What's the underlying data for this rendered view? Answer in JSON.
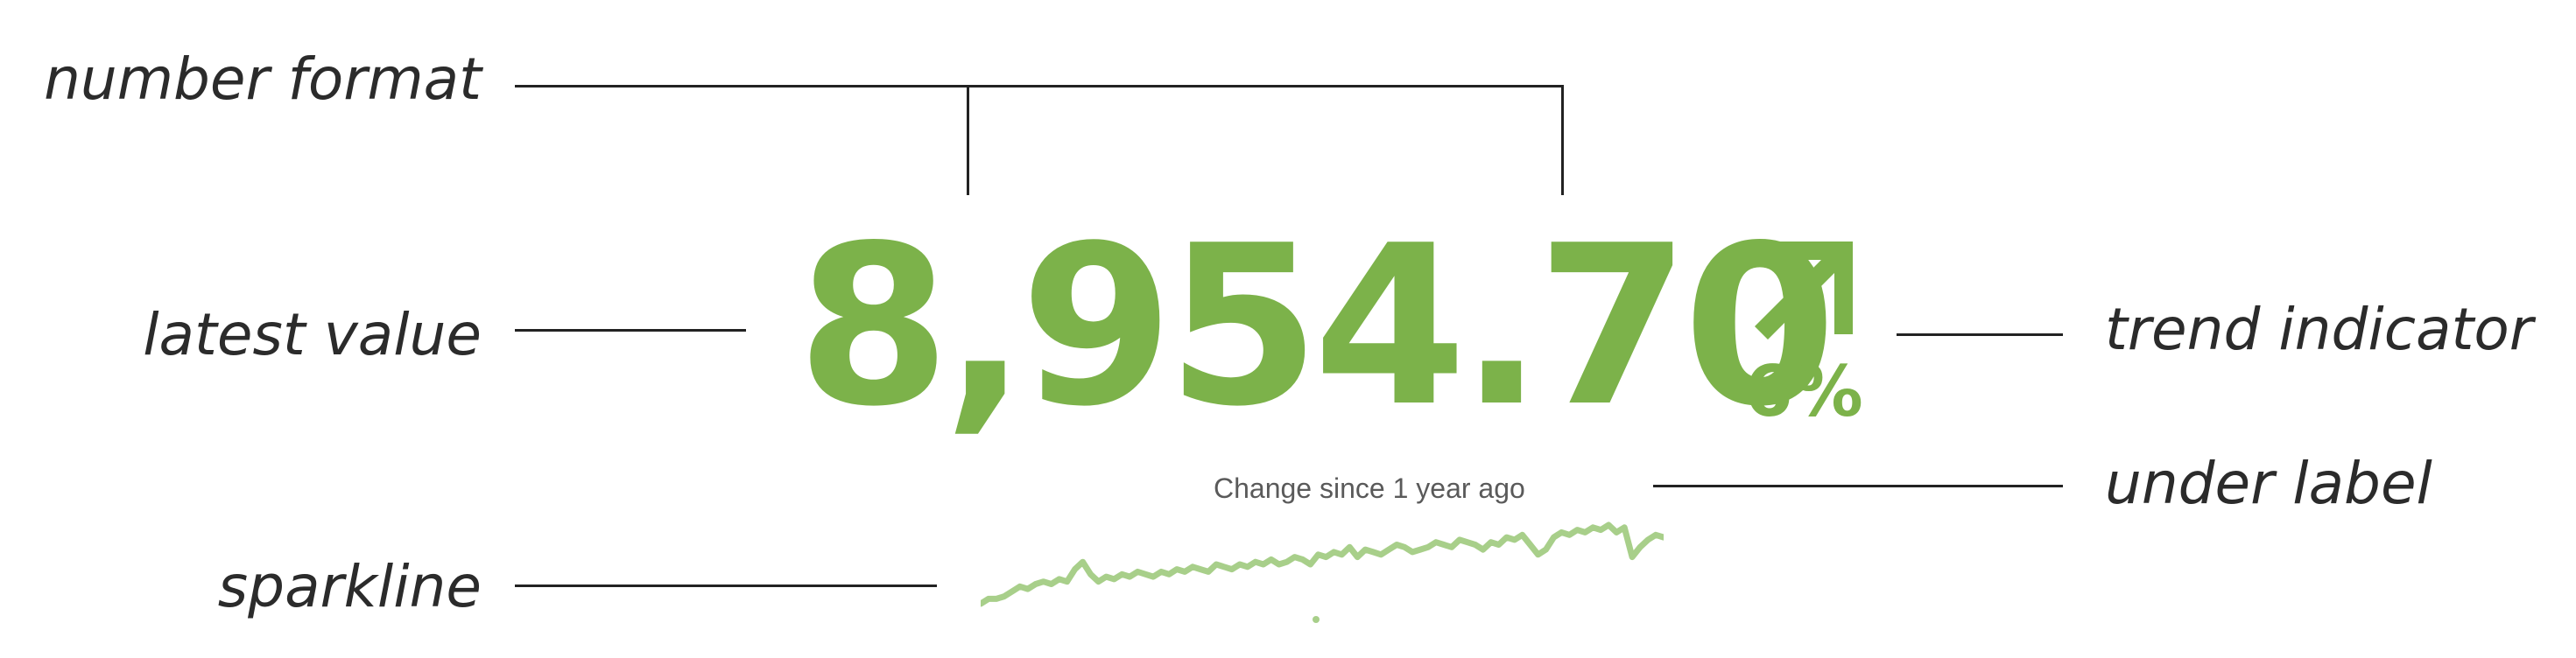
{
  "annotations": {
    "number_format": "number format",
    "latest_value": "latest value",
    "trend_indicator": "trend indicator",
    "under_label": "under label",
    "sparkline": "sparkline"
  },
  "kpi": {
    "value": "8,954.70",
    "trend_percent": "6%",
    "trend_direction": "up",
    "under_label": "Change since 1 year ago",
    "color": "#7cb24a",
    "sparkline_color": "#a8cf8a"
  },
  "sparkline_values": [
    2,
    4,
    4,
    5,
    7,
    9,
    8,
    10,
    11,
    10,
    12,
    11,
    16,
    19,
    14,
    11,
    13,
    12,
    14,
    13,
    15,
    14,
    13,
    15,
    14,
    16,
    15,
    17,
    16,
    15,
    18,
    17,
    16,
    18,
    17,
    19,
    18,
    20,
    18,
    19,
    21,
    20,
    18,
    22,
    21,
    23,
    22,
    25,
    21,
    24,
    23,
    22,
    24,
    26,
    25,
    23,
    24,
    25,
    27,
    26,
    25,
    28,
    27,
    26,
    24,
    27,
    26,
    29,
    28,
    30,
    26,
    22,
    24,
    29,
    31,
    30,
    32,
    31,
    33,
    32,
    34,
    31,
    33,
    21,
    25,
    28,
    30,
    29
  ]
}
